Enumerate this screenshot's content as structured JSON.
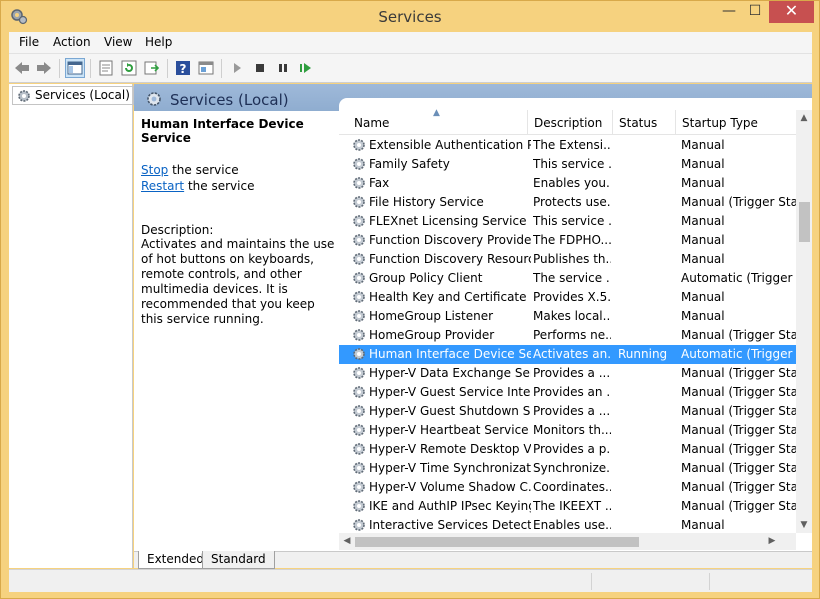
{
  "window": {
    "title": "Services",
    "minimize": "—",
    "maximize": "☐",
    "close": "✕"
  },
  "menu": [
    "File",
    "Action",
    "View",
    "Help"
  ],
  "tree": {
    "root_label": "Services (Local)"
  },
  "panel": {
    "title": "Services (Local)"
  },
  "detail": {
    "service_name": "Human Interface Device Service",
    "stop_link": "Stop",
    "stop_suffix": " the service",
    "restart_link": "Restart",
    "restart_suffix": " the service",
    "description_label": "Description:",
    "description_text": "Activates and maintains the use of hot buttons on keyboards, remote controls, and other multimedia devices. It is recommended that you keep this service running."
  },
  "columns": {
    "name": "Name",
    "description": "Description",
    "status": "Status",
    "startup": "Startup Type"
  },
  "rows": [
    {
      "name": "Extensible Authentication P...",
      "desc": "The Extensi...",
      "status": "",
      "startup": "Manual"
    },
    {
      "name": "Family Safety",
      "desc": "This service ...",
      "status": "",
      "startup": "Manual"
    },
    {
      "name": "Fax",
      "desc": "Enables you...",
      "status": "",
      "startup": "Manual"
    },
    {
      "name": "File History Service",
      "desc": "Protects use...",
      "status": "",
      "startup": "Manual (Trigger Start)"
    },
    {
      "name": "FLEXnet Licensing Service",
      "desc": "This service ...",
      "status": "",
      "startup": "Manual"
    },
    {
      "name": "Function Discovery Provide...",
      "desc": "The FDPHO...",
      "status": "",
      "startup": "Manual"
    },
    {
      "name": "Function Discovery Resourc...",
      "desc": "Publishes th...",
      "status": "",
      "startup": "Manual"
    },
    {
      "name": "Group Policy Client",
      "desc": "The service ...",
      "status": "",
      "startup": "Automatic (Trigger Start)"
    },
    {
      "name": "Health Key and Certificate ...",
      "desc": "Provides X.5...",
      "status": "",
      "startup": "Manual"
    },
    {
      "name": "HomeGroup Listener",
      "desc": "Makes local...",
      "status": "",
      "startup": "Manual"
    },
    {
      "name": "HomeGroup Provider",
      "desc": "Performs ne...",
      "status": "",
      "startup": "Manual (Trigger Start)"
    },
    {
      "name": "Human Interface Device Ser...",
      "desc": "Activates an...",
      "status": "Running",
      "startup": "Automatic (Trigger Start)",
      "selected": true
    },
    {
      "name": "Hyper-V Data Exchange Ser...",
      "desc": "Provides a ...",
      "status": "",
      "startup": "Manual (Trigger Start)"
    },
    {
      "name": "Hyper-V Guest Service Inter...",
      "desc": "Provides an ...",
      "status": "",
      "startup": "Manual (Trigger Start)"
    },
    {
      "name": "Hyper-V Guest Shutdown S...",
      "desc": "Provides a ...",
      "status": "",
      "startup": "Manual (Trigger Start)"
    },
    {
      "name": "Hyper-V Heartbeat Service",
      "desc": "Monitors th...",
      "status": "",
      "startup": "Manual (Trigger Start)"
    },
    {
      "name": "Hyper-V Remote Desktop Vi...",
      "desc": "Provides a p...",
      "status": "",
      "startup": "Manual (Trigger Start)"
    },
    {
      "name": "Hyper-V Time Synchronizat...",
      "desc": "Synchronize...",
      "status": "",
      "startup": "Manual (Trigger Start)"
    },
    {
      "name": "Hyper-V Volume Shadow C...",
      "desc": "Coordinates...",
      "status": "",
      "startup": "Manual (Trigger Start)"
    },
    {
      "name": "IKE and AuthIP IPsec Keying...",
      "desc": "The IKEEXT ...",
      "status": "",
      "startup": "Manual (Trigger Start)"
    },
    {
      "name": "Interactive Services Detection",
      "desc": "Enables use...",
      "status": "",
      "startup": "Manual"
    }
  ],
  "tabs": [
    "Extended",
    "Standard"
  ],
  "icons": {
    "back": "back-arrow-icon",
    "forward": "forward-arrow-icon",
    "console_tree": "console-tree-icon",
    "properties": "properties-icon",
    "refresh": "refresh-icon",
    "export": "export-list-icon",
    "help": "help-icon",
    "view": "view-icon",
    "start": "play-icon",
    "stop": "stop-icon",
    "pause": "pause-icon",
    "restart": "restart-icon",
    "service": "gear-icon"
  },
  "colors": {
    "selection": "#3399ff",
    "header_band": "#9fb9d9",
    "link": "#0a63c4",
    "frame": "#f6d27f"
  }
}
